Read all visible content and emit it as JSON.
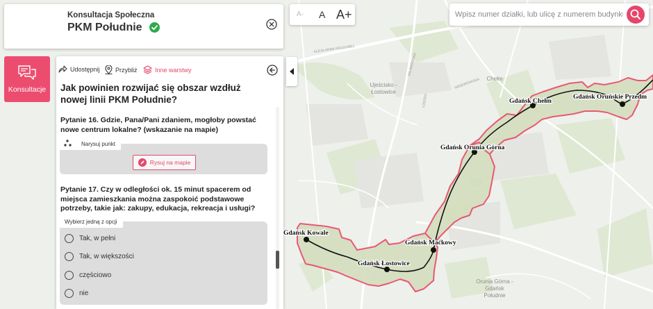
{
  "header": {
    "subtitle": "Konsultacja Społeczna",
    "title": "PKM Południe"
  },
  "text_size": {
    "small": "A-",
    "medium": "A",
    "large": "A+"
  },
  "search": {
    "placeholder": "Wpisz numer działki, lub ulicę z numerem budynku"
  },
  "konsultacje_label": "Konsultacje",
  "toolbar": {
    "share": "Udostępnij",
    "zoom": "Przybliż",
    "layers": "Inne warstwy"
  },
  "main_question": "Jak powinien rozwijać się obszar wzdłuż nowej linii PKM Południe?",
  "q16": {
    "text": "Pytanie 16. Gdzie, Pana/Pani zdaniem, mogłoby powstać nowe centrum lokalne? (wskazanie na mapie)",
    "tab": "Narysuj punkt",
    "button": "Rysuj na mapie"
  },
  "q17": {
    "text": "Pytanie 17. Czy w odległości ok. 15 minut spacerem od miejsca zamieszkania można zaspokoić podstawowe potrzeby, takie jak: zakupy, edukacja, rekreacja i usługi?",
    "tab": "Wybierz jedną z opcji",
    "options": [
      "Tak, w pełni",
      "Tak, w większości",
      "częściowo",
      "nie"
    ]
  },
  "map": {
    "stations": [
      "Gdańsk Kowale",
      "Gdańsk Łostowice",
      "Gdańsk Maćkowy",
      "Gdańsk Orunia Górna",
      "Gdańsk Chełm",
      "Gdańsk Oruńskie Przedm"
    ],
    "place_labels": [
      "Chełm",
      "Ujeścisko - Łostowice",
      "Orunia Górna - Gdańsk Południe"
    ],
    "street_labels": [
      "ALEJA ARMII KRAJOWEJ",
      "ŁÓDZKA",
      "WILANOWSKA",
      "NIEBORÓWSKA"
    ]
  },
  "colors": {
    "accent": "#e6466a",
    "verified": "#2eaa4a",
    "route_fill": "#d5dfbf",
    "route_outline": "#e8506e"
  }
}
